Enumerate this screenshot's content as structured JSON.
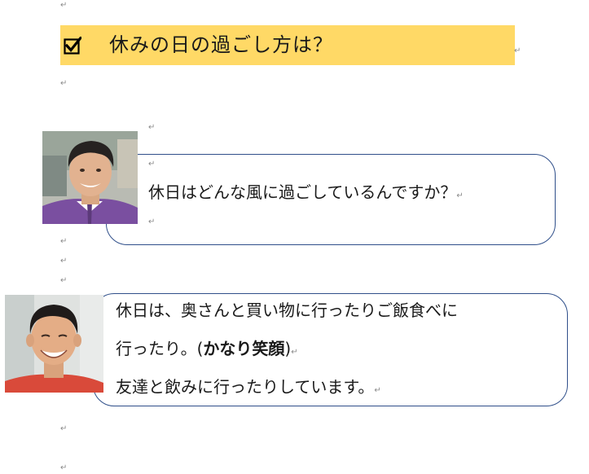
{
  "paragraph_mark": "↵",
  "heading": {
    "icon": "checkbox-checked-icon",
    "text": "休みの日の過ごし方は？",
    "background_color": "#ffd966"
  },
  "question": {
    "avatar": "interviewer-photo",
    "text": "休日はどんな風に過ごしているんですか？"
  },
  "answer": {
    "avatar": "interviewee-photo",
    "line1": "休日は、奥さんと買い物に行ったりご飯食べに",
    "line2_start": "行ったり。(",
    "line2_bold": "かなり笑顔",
    "line2_end": ")",
    "line3": "友達と飲みに行ったりしています。"
  }
}
